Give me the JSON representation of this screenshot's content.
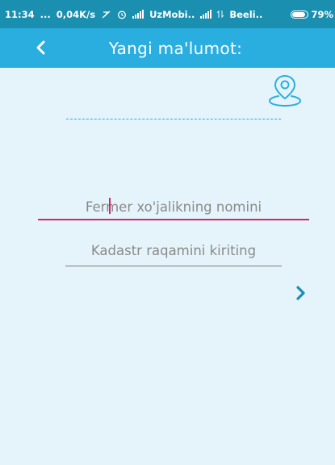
{
  "status_bar": {
    "time": "11:34",
    "dots": "...",
    "speed": "0,04K/s",
    "carrier1": "UzMobi..",
    "carrier2": "Beeli..",
    "battery": "79%"
  },
  "app_bar": {
    "title": "Yangi ma'lumot:",
    "back_icon": "chevron-left-icon",
    "color": "#2aaee0"
  },
  "form": {
    "farm_name_placeholder": "Fermer xo'jalikning nomini",
    "farm_name_value": "",
    "cadastre_placeholder": "Kadastr raqamini kiriting",
    "cadastre_value": "",
    "location_icon": "location-pin-icon",
    "next_icon": "chevron-right-icon",
    "accent_color": "#d6246e"
  }
}
